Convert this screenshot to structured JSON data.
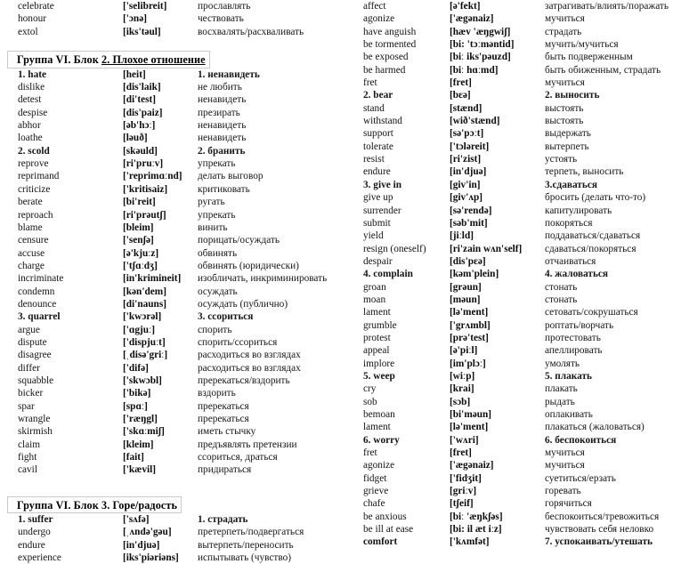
{
  "document": {
    "type": "vocabulary-list",
    "language_pair": "English-Russian",
    "columns": [
      "word",
      "transcription",
      "translation"
    ]
  },
  "left_column": {
    "top_entries": [
      {
        "word": "celebrate",
        "phon": "['selibreit]",
        "trans": "прославлять",
        "bold": false
      },
      {
        "word": "honour",
        "phon": "['ɔnə]",
        "trans": "чествовать",
        "bold": false
      },
      {
        "word": "extol",
        "phon": "[iks'təul]",
        "trans": "восхвалять/расхваливать",
        "bold": false
      }
    ],
    "heading_1": "Группа VI. Блок 2. Плохое отношение",
    "heading_1_plain": "Группа VI. Блок ",
    "heading_1_underlined": "2. Плохое отношение",
    "block2_entries": [
      {
        "word": "1. hate",
        "phon": "[heit]",
        "trans": "1. ненавидеть",
        "bold": true
      },
      {
        "word": "dislike",
        "phon": "[dis'laik]",
        "trans": "не любить",
        "bold": false
      },
      {
        "word": "detest",
        "phon": "[di'test]",
        "trans": "ненавидеть",
        "bold": false
      },
      {
        "word": "despise",
        "phon": "[dis'paiz]",
        "trans": "презирать",
        "bold": false
      },
      {
        "word": "abhor",
        "phon": "[əb'hɔː]",
        "trans": "ненавидеть",
        "bold": false
      },
      {
        "word": "loathe",
        "phon": "[ləuð]",
        "trans": "ненавидеть",
        "bold": false
      },
      {
        "word": "2. scold",
        "phon": "[skəuld]",
        "trans": "2.  бранить",
        "bold": true
      },
      {
        "word": "reprove",
        "phon": "[ri'pruːv]",
        "trans": "упрекать",
        "bold": false
      },
      {
        "word": "reprimand",
        "phon": "['reprimɑːnd]",
        "trans": "делать выговор",
        "bold": false
      },
      {
        "word": "criticize",
        "phon": "['kritisaiz]",
        "trans": "критиковать",
        "bold": false
      },
      {
        "word": "berate",
        "phon": "[bi'reit]",
        "trans": "ругать",
        "bold": false
      },
      {
        "word": "reproach",
        "phon": "[ri'prəutʃ]",
        "trans": "упрекать",
        "bold": false
      },
      {
        "word": "blame",
        "phon": "[bleim]",
        "trans": "винить",
        "bold": false
      },
      {
        "word": "censure",
        "phon": "['senʃə]",
        "trans": "порицать/осуждать",
        "bold": false
      },
      {
        "word": "accuse",
        "phon": "[ə'kjuːz]",
        "trans": "обвинять",
        "bold": false
      },
      {
        "word": "charge",
        "phon": "['tʃɑːdʒ]",
        "trans": "обвинять (юридически)",
        "bold": false
      },
      {
        "word": "incriminate",
        "phon": "[in'krimineit]",
        "trans": "изобличать, инкриминировать",
        "bold": false
      },
      {
        "word": "condemn",
        "phon": "[kən'dem]",
        "trans": "осуждать",
        "bold": false
      },
      {
        "word": "denounce",
        "phon": "[di'nauns]",
        "trans": "осуждать  (публично)",
        "bold": false
      },
      {
        "word": "3.  quarrel",
        "phon": "['kwɔrəl]",
        "trans": "3.  ссориться",
        "bold": true
      },
      {
        "word": "argue",
        "phon": "['ɑgjuː]",
        "trans": "спорить",
        "bold": false
      },
      {
        "word": "dispute",
        "phon": "['dispjuːt]",
        "trans": "спорить/ссориться",
        "bold": false
      },
      {
        "word": "disagree",
        "phon": "[ˌdisə'griː]",
        "trans": "расходиться во взглядах",
        "bold": false
      },
      {
        "word": "differ",
        "phon": "['difə]",
        "trans": "расходиться во взглядах",
        "bold": false
      },
      {
        "word": "squabble",
        "phon": "['skwɔbl]",
        "trans": "пререкаться/вздорить",
        "bold": false
      },
      {
        "word": "bicker",
        "phon": "['bikə]",
        "trans": "вздорить",
        "bold": false
      },
      {
        "word": "spar",
        "phon": "[spɑː]",
        "trans": "пререкаться",
        "bold": false
      },
      {
        "word": "wrangle",
        "phon": "['ræŋgl]",
        "trans": "пререкаться",
        "bold": false
      },
      {
        "word": "skirmish",
        "phon": "['skɑːmiʃ]",
        "trans": "иметь стычку",
        "bold": false
      },
      {
        "word": "claim",
        "phon": "[kleim]",
        "trans": "предъявлять претензии",
        "bold": false
      },
      {
        "word": "fight",
        "phon": "[fait]",
        "trans": "ссориться, драться",
        "bold": false
      },
      {
        "word": "cavil",
        "phon": "['kævil]",
        "trans": "придираться",
        "bold": false
      }
    ],
    "heading_2": "Группа VI. Блок 3. Горе/радость",
    "block3_entries": [
      {
        "word": "1. suffer",
        "phon": "['sʌfə]",
        "trans": "1. страдать",
        "bold": true
      },
      {
        "word": "undergo",
        "phon": "[ˌʌndə'gəu]",
        "trans": "претерпеть/подвергаться",
        "bold": false
      },
      {
        "word": "endure",
        "phon": "[in'djuə]",
        "trans": "вытерпеть/переносить",
        "bold": false
      },
      {
        "word": "experience",
        "phon": "[iks'piəriəns]",
        "trans": "испытывать  (чувство)",
        "bold": false
      }
    ]
  },
  "right_column": {
    "entries": [
      {
        "word": "affect",
        "phon": "[ə'fekt]",
        "trans": "затрагивать/влиять/поражать",
        "bold": false
      },
      {
        "word": "agonize",
        "phon": "['ægənaiz]",
        "trans": "мучиться",
        "bold": false
      },
      {
        "word": "have  anguish",
        "phon": "[hæv 'æŋgwiʃ]",
        "trans": "страдать",
        "bold": false
      },
      {
        "word": "be tormented",
        "phon": "[bi: 'tɔːməntid]",
        "trans": "мучить/мучиться",
        "bold": false
      },
      {
        "word": "be exposed",
        "phon": "[biː iks'pəuzd]",
        "trans": "быть подверженным",
        "bold": false
      },
      {
        "word": "be harmed",
        "phon": "[biː hɑːmd]",
        "trans": "быть обиженным, страдать",
        "bold": false
      },
      {
        "word": "fret",
        "phon": "[fret]",
        "trans": "мучиться",
        "bold": false
      },
      {
        "word": "2. bear",
        "phon": "[bɛə]",
        "trans": "2.  выносить",
        "bold": true
      },
      {
        "word": "stand",
        "phon": "[stænd]",
        "trans": "выстоять",
        "bold": false
      },
      {
        "word": "withstand",
        "phon": "[wið'stænd]",
        "trans": "выстоять",
        "bold": false
      },
      {
        "word": "support",
        "phon": "[sə'pɔːt]",
        "trans": "выдержать",
        "bold": false
      },
      {
        "word": "tolerate",
        "phon": "['tɔləreit]",
        "trans": "вытерпеть",
        "bold": false
      },
      {
        "word": "resist",
        "phon": "[ri'zist]",
        "trans": "устоять",
        "bold": false
      },
      {
        "word": "endure",
        "phon": "[in'djuə]",
        "trans": "терпеть, выносить",
        "bold": false
      },
      {
        "word": "3. give in",
        "phon": "[giv'in]",
        "trans": "3.сдаваться",
        "bold": true
      },
      {
        "word": "give up",
        "phon": "[giv'ʌp]",
        "trans": "бросить (делать что-то)",
        "bold": false
      },
      {
        "word": "surrender",
        "phon": "[sə'rendə]",
        "trans": "капитулировать",
        "bold": false
      },
      {
        "word": "submit",
        "phon": "[səb'mit]",
        "trans": "покоряться",
        "bold": false
      },
      {
        "word": "yield",
        "phon": "[jiːld]",
        "trans": "поддаваться/сдаваться",
        "bold": false
      },
      {
        "word": "resign  (oneself)",
        "phon": "[ri'zain wʌn'self]",
        "trans": "сдаваться/покоряться",
        "bold": false
      },
      {
        "word": "despair",
        "phon": "[dis'pɛə]",
        "trans": "отчаиваться",
        "bold": false
      },
      {
        "word": "4. complain",
        "phon": "[kəm'plein]",
        "trans": "4.  жаловаться",
        "bold": true
      },
      {
        "word": "groan",
        "phon": "[grəun]",
        "trans": "стонать",
        "bold": false
      },
      {
        "word": "moan",
        "phon": "[məun]",
        "trans": "стонать",
        "bold": false
      },
      {
        "word": "lament",
        "phon": "[lə'ment]",
        "trans": "сетовать/сокрушаться",
        "bold": false
      },
      {
        "word": "grumble",
        "phon": "['grʌmbl]",
        "trans": "роптать/ворчать",
        "bold": false
      },
      {
        "word": "protest",
        "phon": "[prə'test]",
        "trans": "протестовать",
        "bold": false
      },
      {
        "word": "appeal",
        "phon": "[ə'piːl]",
        "trans": "апеллировать",
        "bold": false
      },
      {
        "word": "implore",
        "phon": "[im'plɔː]",
        "trans": "умолять",
        "bold": false
      },
      {
        "word": "5. weep",
        "phon": "[wiːp]",
        "trans": "5. плакать",
        "bold": true
      },
      {
        "word": "cry",
        "phon": "[krai]",
        "trans": "плакать",
        "bold": false
      },
      {
        "word": "sob",
        "phon": "[sɔb]",
        "trans": "рыдать",
        "bold": false
      },
      {
        "word": "bemoan",
        "phon": "[bi'məun]",
        "trans": "оплакивать",
        "bold": false
      },
      {
        "word": "lament",
        "phon": "[lə'ment]",
        "trans": "плакаться (жаловаться)",
        "bold": false
      },
      {
        "word": "6. worry",
        "phon": "['wʌri]",
        "trans": "6. беспокоиться",
        "bold": true
      },
      {
        "word": "fret",
        "phon": "[fret]",
        "trans": "мучиться",
        "bold": false
      },
      {
        "word": "agonize",
        "phon": "['ægənaiz]",
        "trans": "мучиться",
        "bold": false
      },
      {
        "word": "fidget",
        "phon": "['fidʒit]",
        "trans": "суетиться/ерзать",
        "bold": false
      },
      {
        "word": "grieve",
        "phon": "[griːv]",
        "trans": "горевать",
        "bold": false
      },
      {
        "word": "chafe",
        "phon": "[tʃeif]",
        "trans": "горячиться",
        "bold": false
      },
      {
        "word": "be anxious",
        "phon": "[biː 'æŋkʃəs]",
        "trans": "беспокоиться/тревожиться",
        "bold": false
      },
      {
        "word": "be ill at ease",
        "phon": "[bi: il æt iːz]",
        "trans": "чувствовать себя  неловко",
        "bold": false
      },
      {
        "word": "comfort",
        "phon": "['kʌmfət]",
        "trans": "7. успокаивать/утешать",
        "bold": true,
        "indent": true
      }
    ]
  }
}
